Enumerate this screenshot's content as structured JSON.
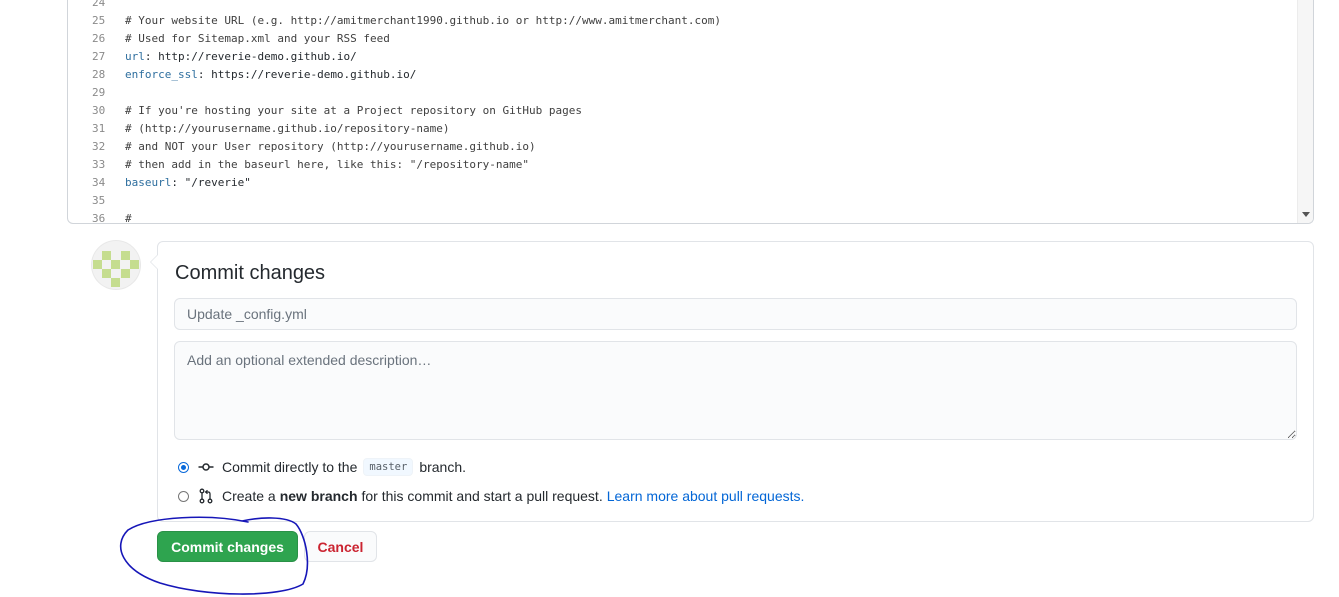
{
  "editor": {
    "lines": [
      {
        "n": "24",
        "type": "blank",
        "text": ""
      },
      {
        "n": "25",
        "type": "comment",
        "text": "# Your website URL (e.g. http://amitmerchant1990.github.io or http://www.amitmerchant.com)"
      },
      {
        "n": "26",
        "type": "comment",
        "text": "# Used for Sitemap.xml and your RSS feed"
      },
      {
        "n": "27",
        "type": "kv",
        "key": "url",
        "value": " http://reverie-demo.github.io/"
      },
      {
        "n": "28",
        "type": "kv",
        "key": "enforce_ssl",
        "value": " https://reverie-demo.github.io/"
      },
      {
        "n": "29",
        "type": "blank",
        "text": ""
      },
      {
        "n": "30",
        "type": "comment",
        "text": "# If you're hosting your site at a Project repository on GitHub pages"
      },
      {
        "n": "31",
        "type": "comment",
        "text": "# (http://yourusername.github.io/repository-name)"
      },
      {
        "n": "32",
        "type": "comment",
        "text": "# and NOT your User repository (http://yourusername.github.io)"
      },
      {
        "n": "33",
        "type": "comment",
        "text": "# then add in the baseurl here, like this: \"/repository-name\""
      },
      {
        "n": "34",
        "type": "kv",
        "key": "baseurl",
        "value": " \"/reverie\""
      },
      {
        "n": "35",
        "type": "blank",
        "text": ""
      },
      {
        "n": "36",
        "type": "comment",
        "text": "#"
      }
    ]
  },
  "commit": {
    "title": "Commit changes",
    "summary_placeholder": "Update _config.yml",
    "description_placeholder": "Add an optional extended description…",
    "option_direct": {
      "prefix": "Commit directly to the",
      "branch": "master",
      "suffix": "branch.",
      "checked": true
    },
    "option_new_branch": {
      "prefix": "Create a",
      "bold": "new branch",
      "suffix": "for this commit and start a pull request.",
      "link": "Learn more about pull requests.",
      "checked": false
    }
  },
  "buttons": {
    "commit_label": "Commit changes",
    "cancel_label": "Cancel"
  },
  "colors": {
    "commit_green": "#2ea44f",
    "cancel_red": "#cb2431",
    "link_blue": "#0366d6",
    "annotation_blue": "#1616b8",
    "avatar_green": "#c5dd8f"
  },
  "icons": {
    "direct": "git-commit-icon",
    "new_branch": "git-pull-request-icon"
  }
}
